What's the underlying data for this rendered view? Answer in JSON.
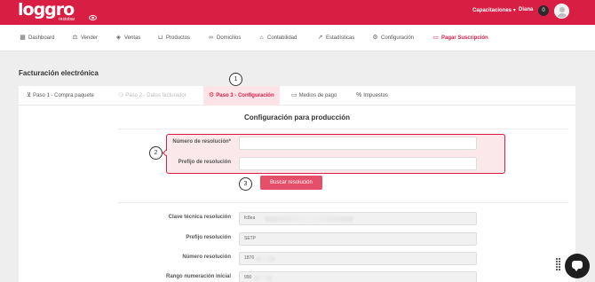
{
  "app": {
    "logo_text": "loggro",
    "logo_sub": "restobar"
  },
  "header": {
    "capacitaciones": "Capacitaciones",
    "user_name": "Diana",
    "notifications": "0"
  },
  "nav": {
    "items": [
      {
        "label": "Dashboard",
        "icon": "dashboard-icon"
      },
      {
        "label": "Vender",
        "icon": "scale-icon"
      },
      {
        "label": "Ventas",
        "icon": "tag-icon"
      },
      {
        "label": "Productos",
        "icon": "basket-icon"
      },
      {
        "label": "Domicilios",
        "icon": "bike-icon"
      },
      {
        "label": "Contabilidad",
        "icon": "bank-icon"
      },
      {
        "label": "Estadísticas",
        "icon": "trend-icon"
      },
      {
        "label": "Configuración",
        "icon": "gear-icon"
      },
      {
        "label": "Pagar Suscripción",
        "icon": "card-icon"
      }
    ],
    "active_color": "#d81e43"
  },
  "page": {
    "section_title": "Facturación electrónica"
  },
  "steps": [
    {
      "label": "Paso 1 - Compra paquete",
      "state": "done"
    },
    {
      "label": "Paso 2 - Datos facturador",
      "state": "disabled"
    },
    {
      "label": "Paso 3 - Configuración",
      "state": "active"
    },
    {
      "label": "Medios de pago",
      "state": "normal"
    },
    {
      "label": "Impuestos",
      "state": "normal"
    }
  ],
  "callouts": {
    "one": "1",
    "two": "2",
    "three": "3"
  },
  "config": {
    "title": "Configuración para producción",
    "numero_resolucion_label": "Número de resolución*",
    "numero_resolucion_value": "",
    "prefijo_resolucion_label": "Prefijo de resolución",
    "prefijo_resolucion_value": "",
    "buscar_button": "Buscar resolución",
    "results": [
      {
        "label": "Clave técnica resolución",
        "value": "fc8ea"
      },
      {
        "label": "Prefijo resolución",
        "value": "SETP"
      },
      {
        "label": "Número resolución",
        "value": "1876"
      },
      {
        "label": "Rango numeración inicial",
        "value": "990"
      }
    ]
  },
  "colors": {
    "brand": "#d81e43",
    "button": "#e4506a"
  }
}
